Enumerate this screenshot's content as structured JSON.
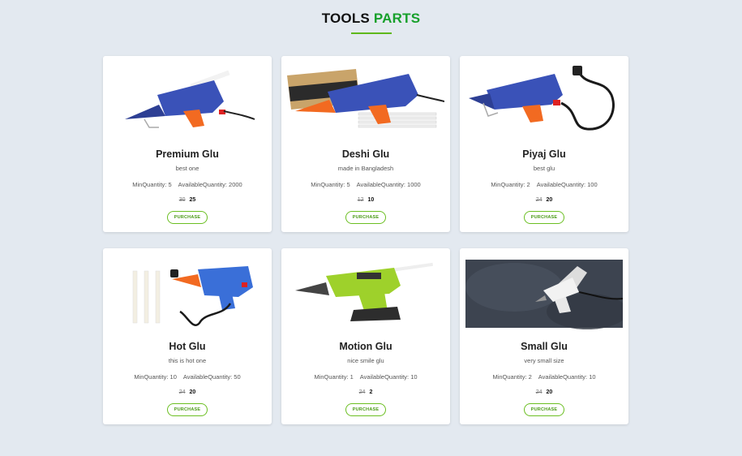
{
  "heading": {
    "part1": "TOOLS",
    "part2": "PARTS"
  },
  "colors": {
    "accent": "#17a02b",
    "button": "#6bbf22",
    "background": "#e3e9f0"
  },
  "products": [
    {
      "name": "Premium Glu",
      "description": "best one",
      "min_label": "MinQuantity: 5",
      "avail_label": "AvailableQuantity: 2000",
      "old_price": "30",
      "price": "25",
      "button": "PURCHASE",
      "image": "blue-glue-gun"
    },
    {
      "name": "Deshi Glu",
      "description": "made in Bangladesh",
      "min_label": "MinQuantity: 5",
      "avail_label": "AvailableQuantity: 1000",
      "old_price": "12",
      "price": "10",
      "button": "PURCHASE",
      "image": "blue-glue-gun-with-box-and-sticks"
    },
    {
      "name": "Piyaj Glu",
      "description": "best glu",
      "min_label": "MinQuantity: 2",
      "avail_label": "AvailableQuantity: 100",
      "old_price": "24",
      "price": "20",
      "button": "PURCHASE",
      "image": "blue-glue-gun-with-plug"
    },
    {
      "name": "Hot Glu",
      "description": "this is hot one",
      "min_label": "MinQuantity: 10",
      "avail_label": "AvailableQuantity: 50",
      "old_price": "24",
      "price": "20",
      "button": "PURCHASE",
      "image": "blue-glue-gun-with-sticks"
    },
    {
      "name": "Motion Glu",
      "description": "nice smile glu",
      "min_label": "MinQuantity: 1",
      "avail_label": "AvailableQuantity: 10",
      "old_price": "24",
      "price": "2",
      "button": "PURCHASE",
      "image": "green-ryobi-glue-gun"
    },
    {
      "name": "Small Glu",
      "description": "very small size",
      "min_label": "MinQuantity: 2",
      "avail_label": "AvailableQuantity: 10",
      "old_price": "24",
      "price": "20",
      "button": "PURCHASE",
      "image": "white-mini-glue-gun"
    }
  ]
}
